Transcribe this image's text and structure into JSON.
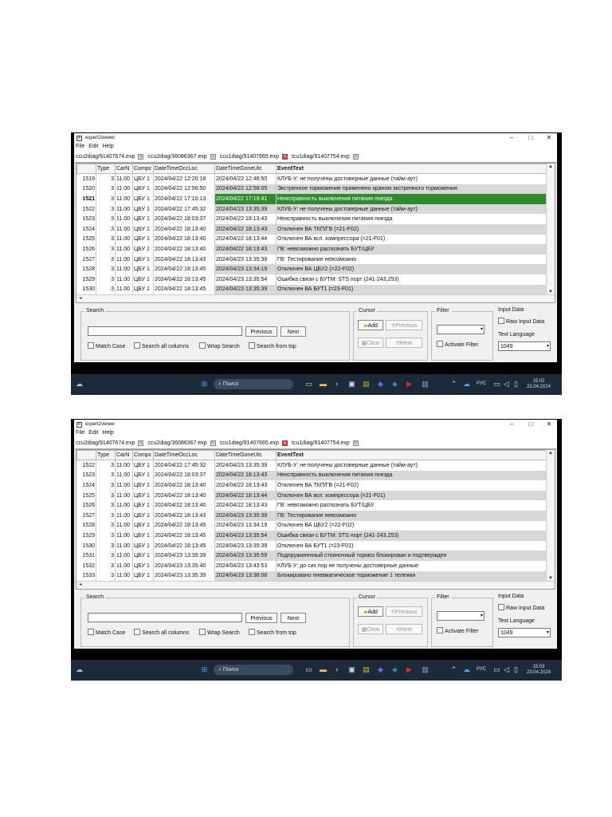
{
  "app": {
    "title": "expert2viewer",
    "menu": [
      "File",
      "Edit",
      "Help"
    ]
  },
  "tabs": [
    {
      "label": "ccu2diag/91407674.exp"
    },
    {
      "label": "ccu2diag/36086367.exp"
    },
    {
      "label": "ccu1diag/91407665.exp",
      "active": true
    },
    {
      "label": "tcu1diag/91407754.exp"
    }
  ],
  "columns": [
    "",
    "Type",
    "CarN",
    "Compc",
    "DateTimeOccLoc",
    "DateTimeGoneUtc",
    "EventText"
  ],
  "screenshots": [
    {
      "rows": [
        {
          "idx": "1519",
          "type": "3",
          "car": "11.00",
          "comp": "ЦБУ 1",
          "occ": "2024/04/22 12:20:18",
          "gone": "2024/04/22 12:46:50",
          "text": "КЛУБ-У: не получены достоверные данные (тайм-аут)"
        },
        {
          "idx": "1520",
          "type": "3",
          "car": "11.00",
          "comp": "ЦБУ 1",
          "occ": "2024/04/22 12:56:50",
          "gone": "2024/04/22 12:58:05",
          "text": "Экстренное торможение применено краном экстренного торможения"
        },
        {
          "idx": "1521",
          "type": "3",
          "car": "11.00",
          "comp": "ЦБУ 1",
          "occ": "2024/04/22 17:10:13",
          "gone": "2024/04/22 17:19:41",
          "text": "Неисправность выключения питания поезда",
          "selected": true
        },
        {
          "idx": "1522",
          "type": "3",
          "car": "11.00",
          "comp": "ЦБУ 1",
          "occ": "2024/04/22 17:45:32",
          "gone": "2024/04/23 13:35:39",
          "text": "КЛУБ-У: не получены достоверные данные (тайм-аут)"
        },
        {
          "idx": "1523",
          "type": "3",
          "car": "11.00",
          "comp": "ЦБУ 1",
          "occ": "2024/04/22 18:03:37",
          "gone": "2024/04/22 18:13:43",
          "text": "Неисправность выключения питания поезда"
        },
        {
          "idx": "1524",
          "type": "3",
          "car": "11.00",
          "comp": "ЦБУ 1",
          "occ": "2024/04/22 18:13:40",
          "gone": "2024/04/22 18:13:43",
          "text": "Отключен ВА ТКП/ГВ (=21-F02)"
        },
        {
          "idx": "1525",
          "type": "3",
          "car": "11.00",
          "comp": "ЦБУ 1",
          "occ": "2024/04/22 18:13:40",
          "gone": "2024/04/22 18:13:44",
          "text": "Отключен ВА всп. компрессора (=21-F01)"
        },
        {
          "idx": "1526",
          "type": "3",
          "car": "11.00",
          "comp": "ЦБУ 1",
          "occ": "2024/04/22 18:13:40",
          "gone": "2024/04/22 18:13:43",
          "text": "ГВ: невозможно распознать БУТ/ЦБУ"
        },
        {
          "idx": "1527",
          "type": "3",
          "car": "11.00",
          "comp": "ЦБУ 1",
          "occ": "2024/04/22 18:13:43",
          "gone": "2024/04/23 13:35:39",
          "text": "ГВ: Тестирование невозможно"
        },
        {
          "idx": "1528",
          "type": "3",
          "car": "11.00",
          "comp": "ЦБУ 1",
          "occ": "2024/04/22 18:13:45",
          "gone": "2024/04/23 13:34:19",
          "text": "Отключен ВА ЦБУ2 (=22-F02)"
        },
        {
          "idx": "1529",
          "type": "3",
          "car": "11.00",
          "comp": "ЦБУ 1",
          "occ": "2024/04/22 18:13:45",
          "gone": "2024/04/23 13:35:54",
          "text": "Ошибка связи с БУТМ: STS порт (241-243,253)"
        },
        {
          "idx": "1530",
          "type": "3",
          "car": "11.00",
          "comp": "ЦБУ 1",
          "occ": "2024/04/22 18:13:45",
          "gone": "2024/04/23 13:35:39",
          "text": "Отключен ВА БУТ1 (=23-F01)"
        }
      ],
      "clock": {
        "time": "15:02",
        "date": "23.04.2024"
      }
    },
    {
      "rows": [
        {
          "idx": "1522",
          "type": "3",
          "car": "11.00",
          "comp": "ЦБУ 1",
          "occ": "2024/04/22 17:45:32",
          "gone": "2024/04/23 13:35:39",
          "text": "КЛУБ-У: не получены достоверные данные (тайм-аут)"
        },
        {
          "idx": "1523",
          "type": "3",
          "car": "11.00",
          "comp": "ЦБУ 1",
          "occ": "2024/04/22 18:03:37",
          "gone": "2024/04/22 18:13:43",
          "text": "Неисправность выключения питания поезда"
        },
        {
          "idx": "1524",
          "type": "3",
          "car": "11.00",
          "comp": "ЦБУ 1",
          "occ": "2024/04/22 18:13:40",
          "gone": "2024/04/22 18:13:43",
          "text": "Отключен ВА ТКП/ГВ (=21-F02)"
        },
        {
          "idx": "1525",
          "type": "3",
          "car": "11.00",
          "comp": "ЦБУ 1",
          "occ": "2024/04/22 18:13:40",
          "gone": "2024/04/22 18:13:44",
          "text": "Отключен ВА всп. компрессора (=21-F01)"
        },
        {
          "idx": "1526",
          "type": "3",
          "car": "11.00",
          "comp": "ЦБУ 1",
          "occ": "2024/04/22 18:13:40",
          "gone": "2024/04/22 18:13:43",
          "text": "ГВ: невозможно распознать БУТ/ЦБУ"
        },
        {
          "idx": "1527",
          "type": "3",
          "car": "11.00",
          "comp": "ЦБУ 1",
          "occ": "2024/04/22 18:13:43",
          "gone": "2024/04/23 13:35:39",
          "text": "ГВ: Тестирование невозможно"
        },
        {
          "idx": "1528",
          "type": "3",
          "car": "11.00",
          "comp": "ЦБУ 1",
          "occ": "2024/04/22 18:13:45",
          "gone": "2024/04/23 13:34:19",
          "text": "Отключен ВА ЦБУ2 (=22-F02)"
        },
        {
          "idx": "1529",
          "type": "3",
          "car": "11.00",
          "comp": "ЦБУ 1",
          "occ": "2024/04/22 18:13:45",
          "gone": "2024/04/23 13:35:54",
          "text": "Ошибка связи с БУТМ: STS порт (241-243,253)"
        },
        {
          "idx": "1530",
          "type": "3",
          "car": "11.00",
          "comp": "ЦБУ 1",
          "occ": "2024/04/22 18:13:45",
          "gone": "2024/04/23 13:35:39",
          "text": "Отключен ВА БУТ1 (=23-F01)"
        },
        {
          "idx": "1531",
          "type": "3",
          "car": "11.00",
          "comp": "ЦБУ 1",
          "occ": "2024/04/23 13:35:39",
          "gone": "2024/04/23 13:35:59",
          "text": "Подпружиненный стояночный тормоз блокирован и подтвержден"
        },
        {
          "idx": "1532",
          "type": "3",
          "car": "11.00",
          "comp": "ЦБУ 1",
          "occ": "2024/04/23 13:35:40",
          "gone": "2024/04/23 13:43:53",
          "text": "КЛУБ-У: до сих пор не получены достоверные данные"
        },
        {
          "idx": "1533",
          "type": "3",
          "car": "11.00",
          "comp": "ЦБУ 1",
          "occ": "2024/04/23 13:35:39",
          "gone": "2024/04/23 13:36:08",
          "text": "Блокировано пневматическое торможение 1 тележки"
        }
      ],
      "clock": {
        "time": "15:03",
        "date": "23.04.2024"
      }
    }
  ],
  "search": {
    "label": "Search",
    "previous": "Previous",
    "next": "Next",
    "match_case": "Match Case",
    "search_all": "Search all columns",
    "wrap": "Wrap Search",
    "from_top": "Search from top"
  },
  "cursor": {
    "label": "Cursor",
    "add": "Add",
    "previous": "Previous",
    "clear": "Clear",
    "next": "Next"
  },
  "filter": {
    "label": "Filter",
    "activate": "Activate Filter"
  },
  "input_data": {
    "label": "Input Data",
    "raw": "Raw Input Data",
    "text_language": "Text Language",
    "language_value": "1049"
  },
  "taskbar": {
    "search": "Поиск",
    "lang": "РУС"
  },
  "colors": {
    "selected_row": "#2e8b2e",
    "grey_row": "#d8d8d8",
    "taskbar": "#1d2a3a"
  }
}
